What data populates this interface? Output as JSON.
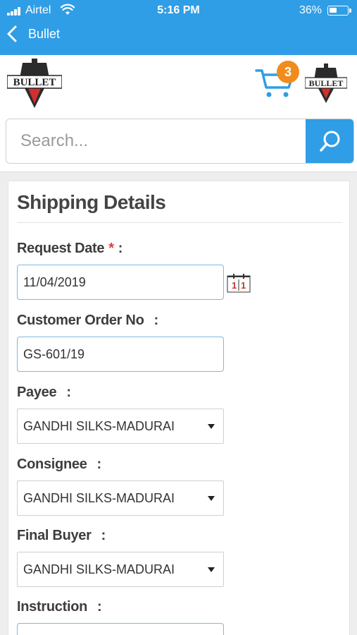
{
  "status_bar": {
    "carrier": "Airtel",
    "time": "5:16 PM",
    "battery": "36%"
  },
  "nav": {
    "back_title": "Bullet"
  },
  "header": {
    "cart_count": "3",
    "brand": "BULLET"
  },
  "search": {
    "placeholder": "Search..."
  },
  "form": {
    "title": "Shipping Details",
    "request_date": {
      "label": "Request Date",
      "required_mark": "*",
      "value": "11/04/2019"
    },
    "customer_order": {
      "label": "Customer Order No",
      "value": "GS-601/19"
    },
    "payee": {
      "label": "Payee",
      "value": "GANDHI SILKS-MADURAI"
    },
    "consignee": {
      "label": "Consignee",
      "value": "GANDHI SILKS-MADURAI"
    },
    "final_buyer": {
      "label": "Final Buyer",
      "value": "GANDHI SILKS-MADURAI"
    },
    "instruction": {
      "label": "Instruction",
      "value": ""
    }
  },
  "colors": {
    "primary": "#2f9ee6",
    "badge": "#f08c1e",
    "required": "#e53935"
  },
  "icons": [
    "signal-icon",
    "wifi-icon",
    "battery-icon",
    "back-chevron-icon",
    "cart-icon",
    "search-icon",
    "calendar-icon",
    "chevron-down-icon"
  ]
}
